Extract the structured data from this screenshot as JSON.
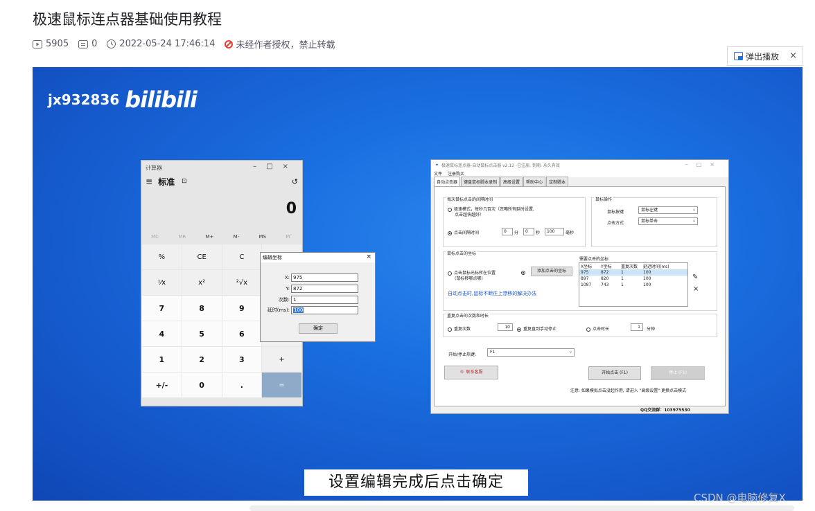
{
  "post": {
    "title": "极速鼠标连点器基础使用教程",
    "views": "5905",
    "comments": "0",
    "datetime": "2022-05-24 17:46:14",
    "notice": "未经作者授权，禁止转载"
  },
  "player": {
    "popout_label": "弹出播放",
    "close": "×",
    "watermark_user": "jx932836",
    "watermark_brand": "bilibili",
    "subtitle": "设置编辑完成后点击确定"
  },
  "calculator": {
    "title": "计算器",
    "window_controls": "–□×",
    "menu": "≡",
    "mode": "标准",
    "mode_icon": "⊡",
    "history_icon": "↺",
    "display": "0",
    "memory": [
      "MC",
      "MR",
      "M+",
      "M-",
      "MS",
      "M˅"
    ],
    "keys": [
      "%",
      "CE",
      "C",
      "",
      "⅟x",
      "x²",
      "²√x",
      "",
      "7",
      "8",
      "9",
      "",
      "4",
      "5",
      "6",
      "",
      "1",
      "2",
      "3",
      "+",
      "+/-",
      "0",
      ".",
      "="
    ]
  },
  "edit_dialog": {
    "title": "编辑坐标",
    "close": "×",
    "x_label": "X:",
    "x_value": "975",
    "y_label": "Y:",
    "y_value": "872",
    "count_label": "次数:",
    "count_value": "1",
    "delay_label": "延时(ms):",
    "delay_value": "100",
    "ok": "确定"
  },
  "clicker": {
    "title": "极速鼠标连点器-自动鼠标点击器 v2.12 -已注册, 到期: 永久有效",
    "window_controls": "–□×",
    "menu": [
      "文件",
      "注册购买"
    ],
    "tabs": [
      "自动点击器",
      "键盘鼠标脚本录制",
      "高级设置",
      "帮助中心",
      "定制脚本"
    ],
    "interval_group": "每次鼠标点击的间隔时间",
    "fast_mode_line1": "极速模式，每秒几百次（忽略所有延时设置,",
    "fast_mode_line2": "点击越快越好）",
    "interval_label": "点击间隔时间",
    "min_value": "0",
    "min_unit": "分",
    "sec_value": "0",
    "sec_unit": "秒",
    "ms_value": "100",
    "ms_unit": "毫秒",
    "mouse_group": "鼠标操作",
    "button_label": "鼠标按键",
    "button_value": "鼠标左键",
    "mode_label": "点击方式",
    "mode_value": "鼠标单击",
    "coord_group": "鼠标点击的坐标",
    "follow_line1": "点击鼠标光标所在位置",
    "follow_line2": "(鼠标移哪点哪)",
    "add_coord": "添加点击的坐标",
    "drift_help": "自动点击时,鼠标不断往上漂移的解决办法",
    "coords_title": "需要点击的坐标",
    "coords_headers": [
      "X坐标",
      "Y坐标",
      "重复次数",
      "延迟时间(ms)"
    ],
    "coords_rows": [
      [
        "975",
        "872",
        "1",
        "100"
      ],
      [
        "897",
        "820",
        "1",
        "100"
      ],
      [
        "1087",
        "743",
        "1",
        "100"
      ]
    ],
    "edit_icon": "✎",
    "delete_icon": "×",
    "repeat_group": "重复点击的次数和时长",
    "repeat_count_label": "重复次数",
    "repeat_count_value": "10",
    "until_stop_label": "重复直到手动停止",
    "duration_label": "点击时长",
    "duration_value": "1",
    "duration_unit": "分钟",
    "hotkey_label": "开始/停止热键:",
    "hotkey_value": "F1",
    "support": "联系客服",
    "start": "开始点击 (F1)",
    "stop": "停止 (F1)",
    "note": "注意: 如果模拟点击没起作用, 请进入 \"高级设置\" 更换点击模式",
    "qq": "QQ交流群：103975530"
  },
  "footer": {
    "csdn": "CSDN @电脑修复X"
  }
}
